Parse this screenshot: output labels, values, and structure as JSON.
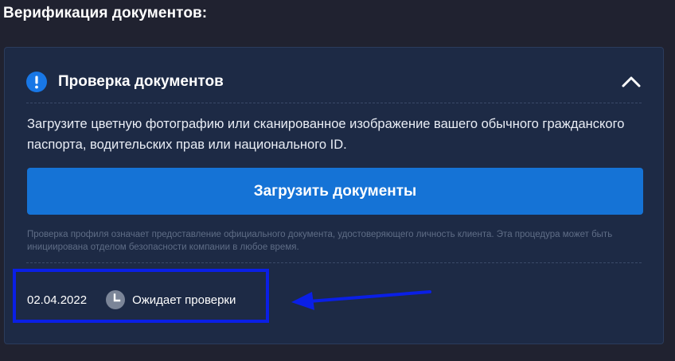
{
  "page": {
    "title": "Верификация документов:"
  },
  "card": {
    "header": {
      "title": "Проверка документов",
      "icon": "exclamation-icon",
      "toggle_icon": "chevron-up-icon"
    },
    "description": "Загрузите цветную фотографию или сканированное изображение вашего обычного гражданского паспорта, водительских прав или национального ID.",
    "upload_button_label": "Загрузить документы",
    "note": "Проверка профиля означает предоставление официального документа, удостоверяющего личность клиента. Эта процедура может быть инициирована отделом безопасности компании в любое время.",
    "status": {
      "date": "02.04.2022",
      "icon": "clock-icon",
      "label": "Ожидает проверки"
    }
  },
  "colors": {
    "page_background": "#202230",
    "card_background": "#1d2a45",
    "accent_blue": "#1573d6",
    "annotation_blue": "#0a1fe6",
    "muted_text": "#5f6d86"
  }
}
